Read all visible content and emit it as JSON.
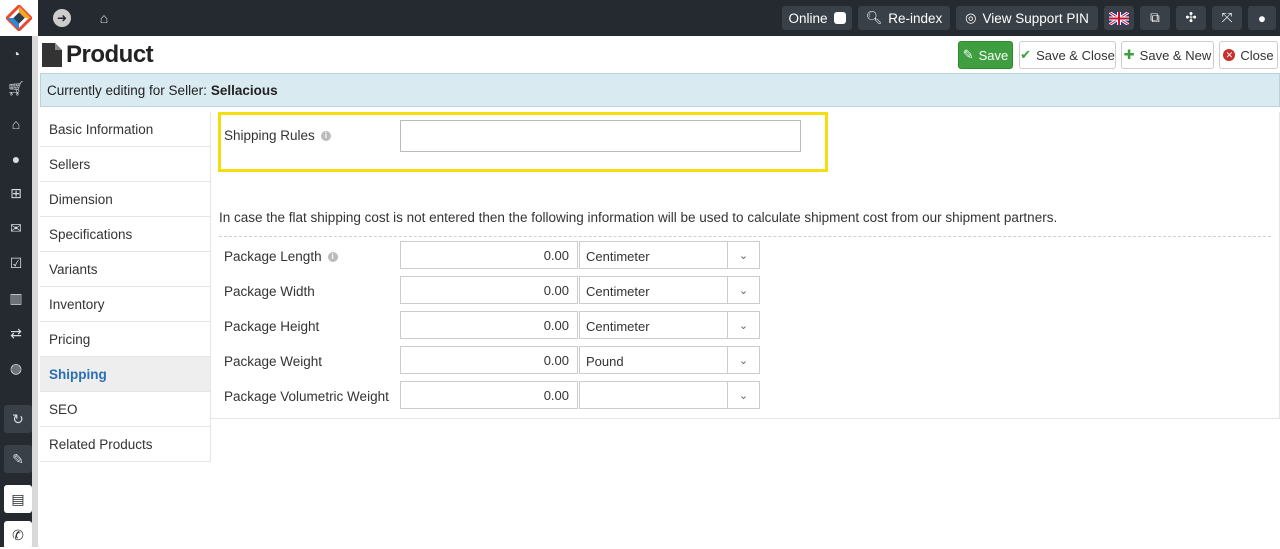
{
  "topbar": {
    "online_label": "Online",
    "reindex_label": "Re-index",
    "support_pin_label": "View Support PIN"
  },
  "page": {
    "title": "Product"
  },
  "toolbar": {
    "save_label": "Save",
    "save_close_label": "Save & Close",
    "save_new_label": "Save & New",
    "close_label": "Close"
  },
  "alert": {
    "prefix": "Currently editing for Seller:",
    "seller": "Sellacious"
  },
  "tabs": [
    {
      "label": "Basic Information"
    },
    {
      "label": "Sellers"
    },
    {
      "label": "Dimension"
    },
    {
      "label": "Specifications"
    },
    {
      "label": "Variants"
    },
    {
      "label": "Inventory"
    },
    {
      "label": "Pricing"
    },
    {
      "label": "Shipping"
    },
    {
      "label": "SEO"
    },
    {
      "label": "Related Products"
    }
  ],
  "shipping": {
    "rules_label": "Shipping Rules",
    "rules_value": "",
    "note": "In case the flat shipping cost is not entered then the following information will be used to calculate shipment cost from our shipment partners.",
    "rows": [
      {
        "label": "Package Length",
        "value": "0.00",
        "unit": "Centimeter"
      },
      {
        "label": "Package Width",
        "value": "0.00",
        "unit": "Centimeter"
      },
      {
        "label": "Package Height",
        "value": "0.00",
        "unit": "Centimeter"
      },
      {
        "label": "Package Weight",
        "value": "0.00",
        "unit": "Pound"
      },
      {
        "label": "Package Volumetric Weight",
        "value": "0.00",
        "unit": ""
      }
    ]
  },
  "colors": {
    "topbar": "#252a30",
    "save_green": "#3f9e3f",
    "active_tab": "#2a6fb5",
    "highlight": "#f5de0f",
    "alert_bg": "#d9ebf1"
  }
}
